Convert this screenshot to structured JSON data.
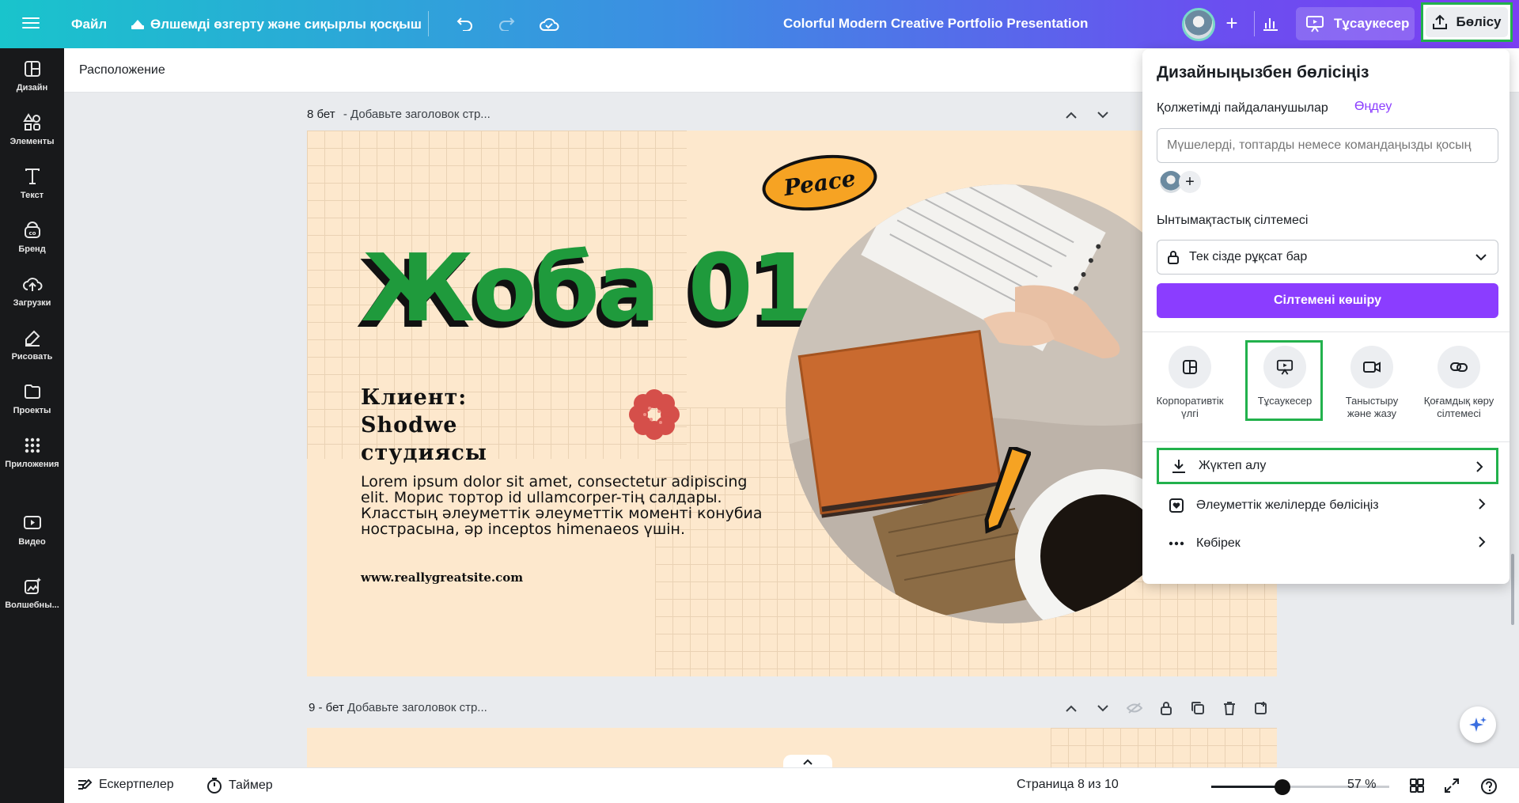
{
  "topbar": {
    "file_label": "Файл",
    "resize_label": "Өлшемді өзгерту және сиқырлы қосқыш",
    "doc_title": "Colorful Modern Creative Portfolio Presentation",
    "present_label": "Тұсаукесер",
    "share_label": "Бөлісу"
  },
  "sidebar": {
    "items": [
      {
        "label": "Дизайн",
        "icon": "layout-icon"
      },
      {
        "label": "Элементы",
        "icon": "shapes-icon"
      },
      {
        "label": "Текст",
        "icon": "text-icon"
      },
      {
        "label": "Бренд",
        "icon": "brand-icon"
      },
      {
        "label": "Загрузки",
        "icon": "upload-cloud-icon"
      },
      {
        "label": "Рисовать",
        "icon": "draw-icon"
      },
      {
        "label": "Проекты",
        "icon": "folder-icon"
      },
      {
        "label": "Приложения",
        "icon": "apps-icon"
      },
      {
        "label": "Видео",
        "icon": "video-icon"
      },
      {
        "label": "Волшебны...",
        "icon": "magic-media-icon"
      }
    ]
  },
  "subheader": {
    "label": "Расположение"
  },
  "page8": {
    "number": "8 бет",
    "title_placeholder": "- Добавьте заголовок стр..."
  },
  "page9": {
    "number": "9 -  бет",
    "title_placeholder": "Добавьте заголовок стр..."
  },
  "slide": {
    "title": "Жоба 01",
    "client": "Клиент: Shodwe студиясы",
    "body": "Lorem ipsum dolor sit amet, consectetur adipiscing elit. Морис тортор id ullamcorper-тің салдары. Класстың әлеуметтік әлеуметтік моменті конубиа ностраcына, әр inceptos himenaeos үшін.",
    "site": "www.reallygreatsite.com",
    "badge": "Peace"
  },
  "bottombar": {
    "notes_label": "Ескертпелер",
    "timer_label": "Таймер",
    "page_counter": "Страница 8 из 10",
    "zoom_label": "57 %",
    "zoom_fraction": 0.4
  },
  "share_panel": {
    "title": "Дизайныңызбен бөлісіңіз",
    "access_label": "Қолжетімді пайдаланушылар",
    "edit_link": "Өңдеу",
    "people_placeholder": "Мүшелерді, топтарды немесе командаңызды қосың",
    "collab_label": "Ынтымақтастық сілтемесі",
    "access_select": "Тек сізде рұқсат бар",
    "copy_link_button": "Сілтемені көшіру",
    "options": [
      {
        "label": "Корпоративтік үлгі",
        "icon": "template-icon"
      },
      {
        "label": "Тұсаукесер",
        "icon": "present-icon"
      },
      {
        "label": "Таныстыру және жазу",
        "icon": "record-icon"
      },
      {
        "label": "Қоғамдық көру сілтемесі",
        "icon": "link-icon"
      }
    ],
    "rows": [
      {
        "label": "Жүктеп алу",
        "icon": "download-icon"
      },
      {
        "label": "Әлеуметтік желілерде бөлісіңіз",
        "icon": "heart-share-icon"
      },
      {
        "label": "Көбірек",
        "icon": "more-dots-icon"
      }
    ]
  },
  "colors": {
    "accent": "#8b3dff",
    "highlight": "#22b14c",
    "slide_bg": "#fde8cd",
    "title_green": "#1f9a3c"
  }
}
